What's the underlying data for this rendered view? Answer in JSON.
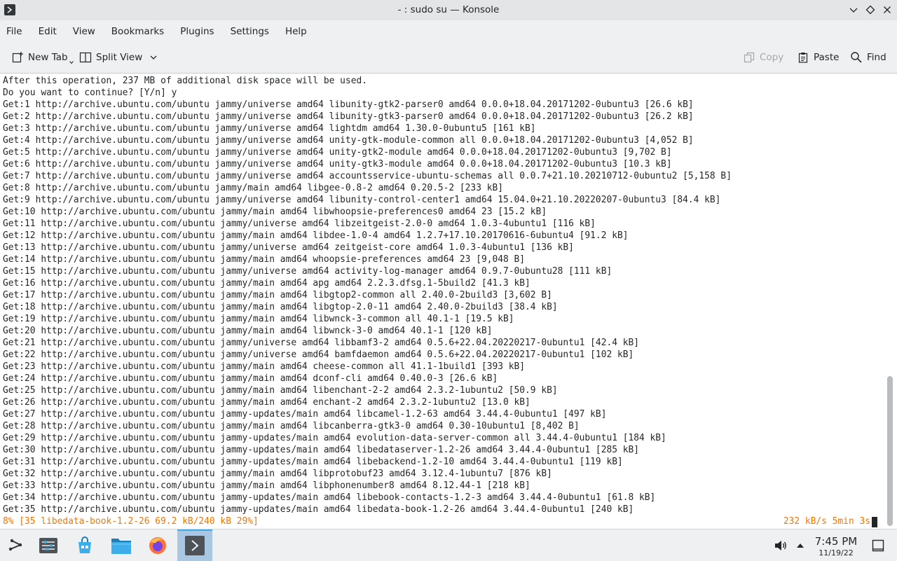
{
  "window": {
    "title": "- : sudo su — Konsole"
  },
  "menu": {
    "items": [
      "File",
      "Edit",
      "View",
      "Bookmarks",
      "Plugins",
      "Settings",
      "Help"
    ]
  },
  "toolbar": {
    "new_tab": "New Tab",
    "split_view": "Split View",
    "copy": "Copy",
    "paste": "Paste",
    "find": "Find"
  },
  "terminal": {
    "lines": [
      "After this operation, 237 MB of additional disk space will be used.",
      "Do you want to continue? [Y/n] y",
      "Get:1 http://archive.ubuntu.com/ubuntu jammy/universe amd64 libunity-gtk2-parser0 amd64 0.0.0+18.04.20171202-0ubuntu3 [26.6 kB]",
      "Get:2 http://archive.ubuntu.com/ubuntu jammy/universe amd64 libunity-gtk3-parser0 amd64 0.0.0+18.04.20171202-0ubuntu3 [26.2 kB]",
      "Get:3 http://archive.ubuntu.com/ubuntu jammy/universe amd64 lightdm amd64 1.30.0-0ubuntu5 [161 kB]",
      "Get:4 http://archive.ubuntu.com/ubuntu jammy/universe amd64 unity-gtk-module-common all 0.0.0+18.04.20171202-0ubuntu3 [4,052 B]",
      "Get:5 http://archive.ubuntu.com/ubuntu jammy/universe amd64 unity-gtk2-module amd64 0.0.0+18.04.20171202-0ubuntu3 [9,702 B]",
      "Get:6 http://archive.ubuntu.com/ubuntu jammy/universe amd64 unity-gtk3-module amd64 0.0.0+18.04.20171202-0ubuntu3 [10.3 kB]",
      "Get:7 http://archive.ubuntu.com/ubuntu jammy/universe amd64 accountsservice-ubuntu-schemas all 0.0.7+21.10.20210712-0ubuntu2 [5,158 B]",
      "Get:8 http://archive.ubuntu.com/ubuntu jammy/main amd64 libgee-0.8-2 amd64 0.20.5-2 [233 kB]",
      "Get:9 http://archive.ubuntu.com/ubuntu jammy/universe amd64 libunity-control-center1 amd64 15.04.0+21.10.20220207-0ubuntu3 [84.4 kB]",
      "Get:10 http://archive.ubuntu.com/ubuntu jammy/main amd64 libwhoopsie-preferences0 amd64 23 [15.2 kB]",
      "Get:11 http://archive.ubuntu.com/ubuntu jammy/universe amd64 libzeitgeist-2.0-0 amd64 1.0.3-4ubuntu1 [116 kB]",
      "Get:12 http://archive.ubuntu.com/ubuntu jammy/main amd64 libdee-1.0-4 amd64 1.2.7+17.10.20170616-6ubuntu4 [91.2 kB]",
      "Get:13 http://archive.ubuntu.com/ubuntu jammy/universe amd64 zeitgeist-core amd64 1.0.3-4ubuntu1 [136 kB]",
      "Get:14 http://archive.ubuntu.com/ubuntu jammy/main amd64 whoopsie-preferences amd64 23 [9,048 B]",
      "Get:15 http://archive.ubuntu.com/ubuntu jammy/universe amd64 activity-log-manager amd64 0.9.7-0ubuntu28 [111 kB]",
      "Get:16 http://archive.ubuntu.com/ubuntu jammy/main amd64 apg amd64 2.2.3.dfsg.1-5build2 [41.3 kB]",
      "Get:17 http://archive.ubuntu.com/ubuntu jammy/main amd64 libgtop2-common all 2.40.0-2build3 [3,602 B]",
      "Get:18 http://archive.ubuntu.com/ubuntu jammy/main amd64 libgtop-2.0-11 amd64 2.40.0-2build3 [38.4 kB]",
      "Get:19 http://archive.ubuntu.com/ubuntu jammy/main amd64 libwnck-3-common all 40.1-1 [19.5 kB]",
      "Get:20 http://archive.ubuntu.com/ubuntu jammy/main amd64 libwnck-3-0 amd64 40.1-1 [120 kB]",
      "Get:21 http://archive.ubuntu.com/ubuntu jammy/universe amd64 libbamf3-2 amd64 0.5.6+22.04.20220217-0ubuntu1 [42.4 kB]",
      "Get:22 http://archive.ubuntu.com/ubuntu jammy/universe amd64 bamfdaemon amd64 0.5.6+22.04.20220217-0ubuntu1 [102 kB]",
      "Get:23 http://archive.ubuntu.com/ubuntu jammy/main amd64 cheese-common all 41.1-1build1 [393 kB]",
      "Get:24 http://archive.ubuntu.com/ubuntu jammy/main amd64 dconf-cli amd64 0.40.0-3 [26.6 kB]",
      "Get:25 http://archive.ubuntu.com/ubuntu jammy/main amd64 libenchant-2-2 amd64 2.3.2-1ubuntu2 [50.9 kB]",
      "Get:26 http://archive.ubuntu.com/ubuntu jammy/main amd64 enchant-2 amd64 2.3.2-1ubuntu2 [13.0 kB]",
      "Get:27 http://archive.ubuntu.com/ubuntu jammy-updates/main amd64 libcamel-1.2-63 amd64 3.44.4-0ubuntu1 [497 kB]",
      "Get:28 http://archive.ubuntu.com/ubuntu jammy/main amd64 libcanberra-gtk3-0 amd64 0.30-10ubuntu1 [8,402 B]",
      "Get:29 http://archive.ubuntu.com/ubuntu jammy-updates/main amd64 evolution-data-server-common all 3.44.4-0ubuntu1 [184 kB]",
      "Get:30 http://archive.ubuntu.com/ubuntu jammy-updates/main amd64 libedataserver-1.2-26 amd64 3.44.4-0ubuntu1 [285 kB]",
      "Get:31 http://archive.ubuntu.com/ubuntu jammy-updates/main amd64 libebackend-1.2-10 amd64 3.44.4-0ubuntu1 [119 kB]",
      "Get:32 http://archive.ubuntu.com/ubuntu jammy/main amd64 libprotobuf23 amd64 3.12.4-1ubuntu7 [876 kB]",
      "Get:33 http://archive.ubuntu.com/ubuntu jammy/main amd64 libphonenumber8 amd64 8.12.44-1 [218 kB]",
      "Get:34 http://archive.ubuntu.com/ubuntu jammy-updates/main amd64 libebook-contacts-1.2-3 amd64 3.44.4-0ubuntu1 [61.8 kB]",
      "Get:35 http://archive.ubuntu.com/ubuntu jammy-updates/main amd64 libedata-book-1.2-26 amd64 3.44.4-0ubuntu1 [240 kB]"
    ],
    "status_left": "8% [35 libedata-book-1.2-26 69.2 kB/240 kB 29%]",
    "status_right": "232 kB/s 5min 3s"
  },
  "taskbar": {
    "time": "7:45 PM",
    "date": "11/19/22"
  },
  "colors": {
    "status_orange": "#f67400",
    "active_task": "#a9c7e3",
    "accent": "#3daee9"
  }
}
